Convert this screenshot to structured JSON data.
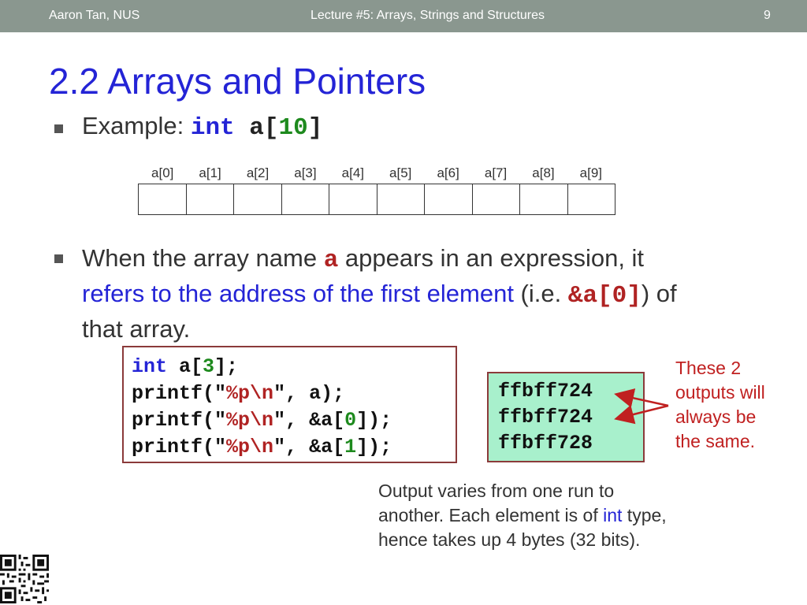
{
  "header": {
    "author": "Aaron Tan, NUS",
    "lecture": "Lecture #5: Arrays, Strings and Structures",
    "page": "9"
  },
  "title": "2.2 Arrays and Pointers",
  "bullet1": {
    "prefix": "Example: ",
    "code_kw": "int",
    "code_rest": " a[",
    "code_num": "10",
    "code_close": "]"
  },
  "array_labels": [
    "a[0]",
    "a[1]",
    "a[2]",
    "a[3]",
    "a[4]",
    "a[5]",
    "a[6]",
    "a[7]",
    "a[8]",
    "a[9]"
  ],
  "bullet2": {
    "t1": "When the array name ",
    "code_a": "a",
    "t2": " appears in an expression, it",
    "blue": "refers to the address of the first element",
    "t3": " (i.e. ",
    "code_addr": "&a[0]",
    "t4": ") of",
    "t5": "that array."
  },
  "code": {
    "l1_kw": "int",
    "l1_a": " a[",
    "l1_num": "3",
    "l1_end": "];",
    "printf": "printf(",
    "q": "\"",
    "fmt": "%p\\n",
    "l2_end": ", a);",
    "l3_mid": ", &a[",
    "l3_num": "0",
    "l3_end": "]);",
    "l4_mid": ", &a[",
    "l4_num": "1",
    "l4_end": "]);"
  },
  "output_lines": [
    "ffbff724",
    "ffbff724",
    "ffbff728"
  ],
  "note_lines": [
    "These 2",
    "outputs will",
    "always be",
    "the same."
  ],
  "caption": {
    "l1": "Output varies from one run to",
    "l2a": "another. Each element is of ",
    "l2_int": "int",
    "l2b": " type,",
    "l3": "hence takes up 4 bytes (32 bits)."
  },
  "colors": {
    "header_bg": "#8a978f",
    "title": "#2424d6",
    "keyword_blue": "#2424d6",
    "string_red": "#b02323",
    "number_green": "#1e8a1e",
    "output_bg": "#a8f0cc",
    "note_red": "#c02020"
  }
}
